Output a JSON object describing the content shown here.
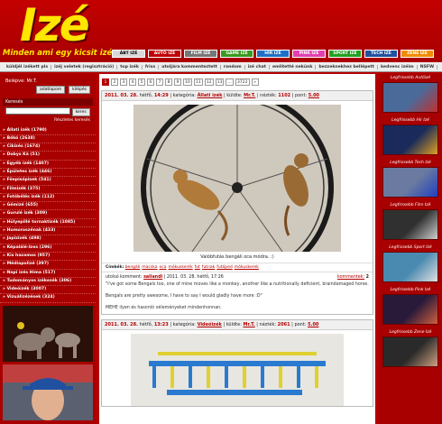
{
  "header": {
    "logo": "Izé",
    "slogan": "Minden ami egy kicsit izé",
    "categories": [
      {
        "label": "ÁBT IZÉ",
        "color": "#d9d9d9",
        "text": "#000000"
      },
      {
        "label": "AUTÓ IZÉ",
        "color": "#c00000",
        "text": "#ffffff"
      },
      {
        "label": "FILM IZÉ",
        "color": "#777777",
        "text": "#ffffff"
      },
      {
        "label": "GAME IZÉ",
        "color": "#3a9a20",
        "text": "#ffffff"
      },
      {
        "label": "HÍR IZÉ",
        "color": "#1f6fc6",
        "text": "#ffffff"
      },
      {
        "label": "PINK IZÉ",
        "color": "#e040b0",
        "text": "#ffffff"
      },
      {
        "label": "SPORT IZÉ",
        "color": "#22a022",
        "text": "#ffffff"
      },
      {
        "label": "TECH IZÉ",
        "color": "#2050a0",
        "text": "#ffffff"
      },
      {
        "label": "ZENE IZÉ",
        "color": "#f08c00",
        "text": "#ffffff"
      }
    ]
  },
  "nav": {
    "links": [
      "küldjél izékett pls",
      "izéj veletek (regisztráció)",
      "top izék",
      "friss",
      "utoljára kommenteztett",
      "random",
      "izé chat",
      "emlitetté nekünk",
      "bezzeknekhez bellépett",
      "kedvenc izéim",
      "NSFW"
    ]
  },
  "left": {
    "login_label": "Belépve: Mr.T.",
    "btn_profile": "adatlapom",
    "btn_logout": "kilépés",
    "search_title": "Keresés",
    "search_button": "keres",
    "advanced_search": "Részletes keresés",
    "categories": [
      "Állati izék (1790)",
      "Bőkó (2638)",
      "Cikizés (1674)",
      "Dobys Ká (51)",
      "Egyéb izék (1407)",
      "Épületes izék (446)",
      "Főepisópisek (541)",
      "Filmizék (375)",
      "Fotóbélés izék (112)",
      "Gémizé (655)",
      "Gurulé izék (309)",
      "Hülyepillé tornaktizék (1085)",
      "Humoroszénak (433)",
      "Japizizék (498)",
      "Képalálé-Izes (296)",
      "Kis hazamos (957)",
      "Médiapolizé (397)",
      "Napi izés Híma (517)",
      "Tudományos izékezék (306)",
      "Videóizék (3007)",
      "Vizuálizézések (324)"
    ]
  },
  "pager": {
    "pages": [
      "1",
      "2",
      "3",
      "4",
      "5",
      "6",
      "7",
      "8",
      "9",
      "10",
      "11",
      "12",
      "13",
      "...",
      "3722",
      "»"
    ],
    "active": "1"
  },
  "posts": [
    {
      "date": "2011. 03. 28.",
      "day": "hétfő,",
      "time": "14:29",
      "category_label": "kategória:",
      "category": "Állati izék",
      "sender_label": "küldte:",
      "sender": "Mr.T.",
      "views_label": "nézték:",
      "views": "1102",
      "points_label": "pont:",
      "points": "5.00",
      "caption": "Valóbfutás bengáli oca módra. :)",
      "tags_label": "Címkék:",
      "tags": [
        "bengáli",
        "macska",
        "oca",
        "mókuskerék",
        "fut",
        "futnak",
        "futóped",
        "mókuskerek"
      ],
      "last_comment_label": "utolsó komment:",
      "last_comment_user": "saliandi",
      "last_comment_date": "2011. 03. 28. hétfő, 17:26",
      "comments_label": "kommentek:",
      "comments": "2",
      "comment_text_1": "\"I've got some Bengals too, one of mine moves like a monkey, another like a nutritionally deficient, braindamaged horse.",
      "comment_text_2": "Bengals are pretty awesome, I have to say I would gladly have more :D\"",
      "comment_text_3": "MEHE ilyen és hasonló véleményeket mindenhonnan."
    },
    {
      "date": "2011. 03. 28.",
      "day": "hétfő,",
      "time": "13:23",
      "category_label": "kategória:",
      "category": "Videóizék",
      "sender_label": "küldte:",
      "sender": "Mr.T.",
      "views_label": "nézték:",
      "views": "2061",
      "points_label": "pont:",
      "points": "5.00"
    }
  ],
  "right": {
    "titles": [
      "Legfrissebb Autóizé",
      "Legfrissebb Hír Izé",
      "Legfrissebb Tech Izé",
      "Legfrissebb Film Izé",
      "Legfrissebb Sport Izé",
      "Legfrissebb Pink Izé",
      "Legfrissebb Zene Izé"
    ]
  }
}
